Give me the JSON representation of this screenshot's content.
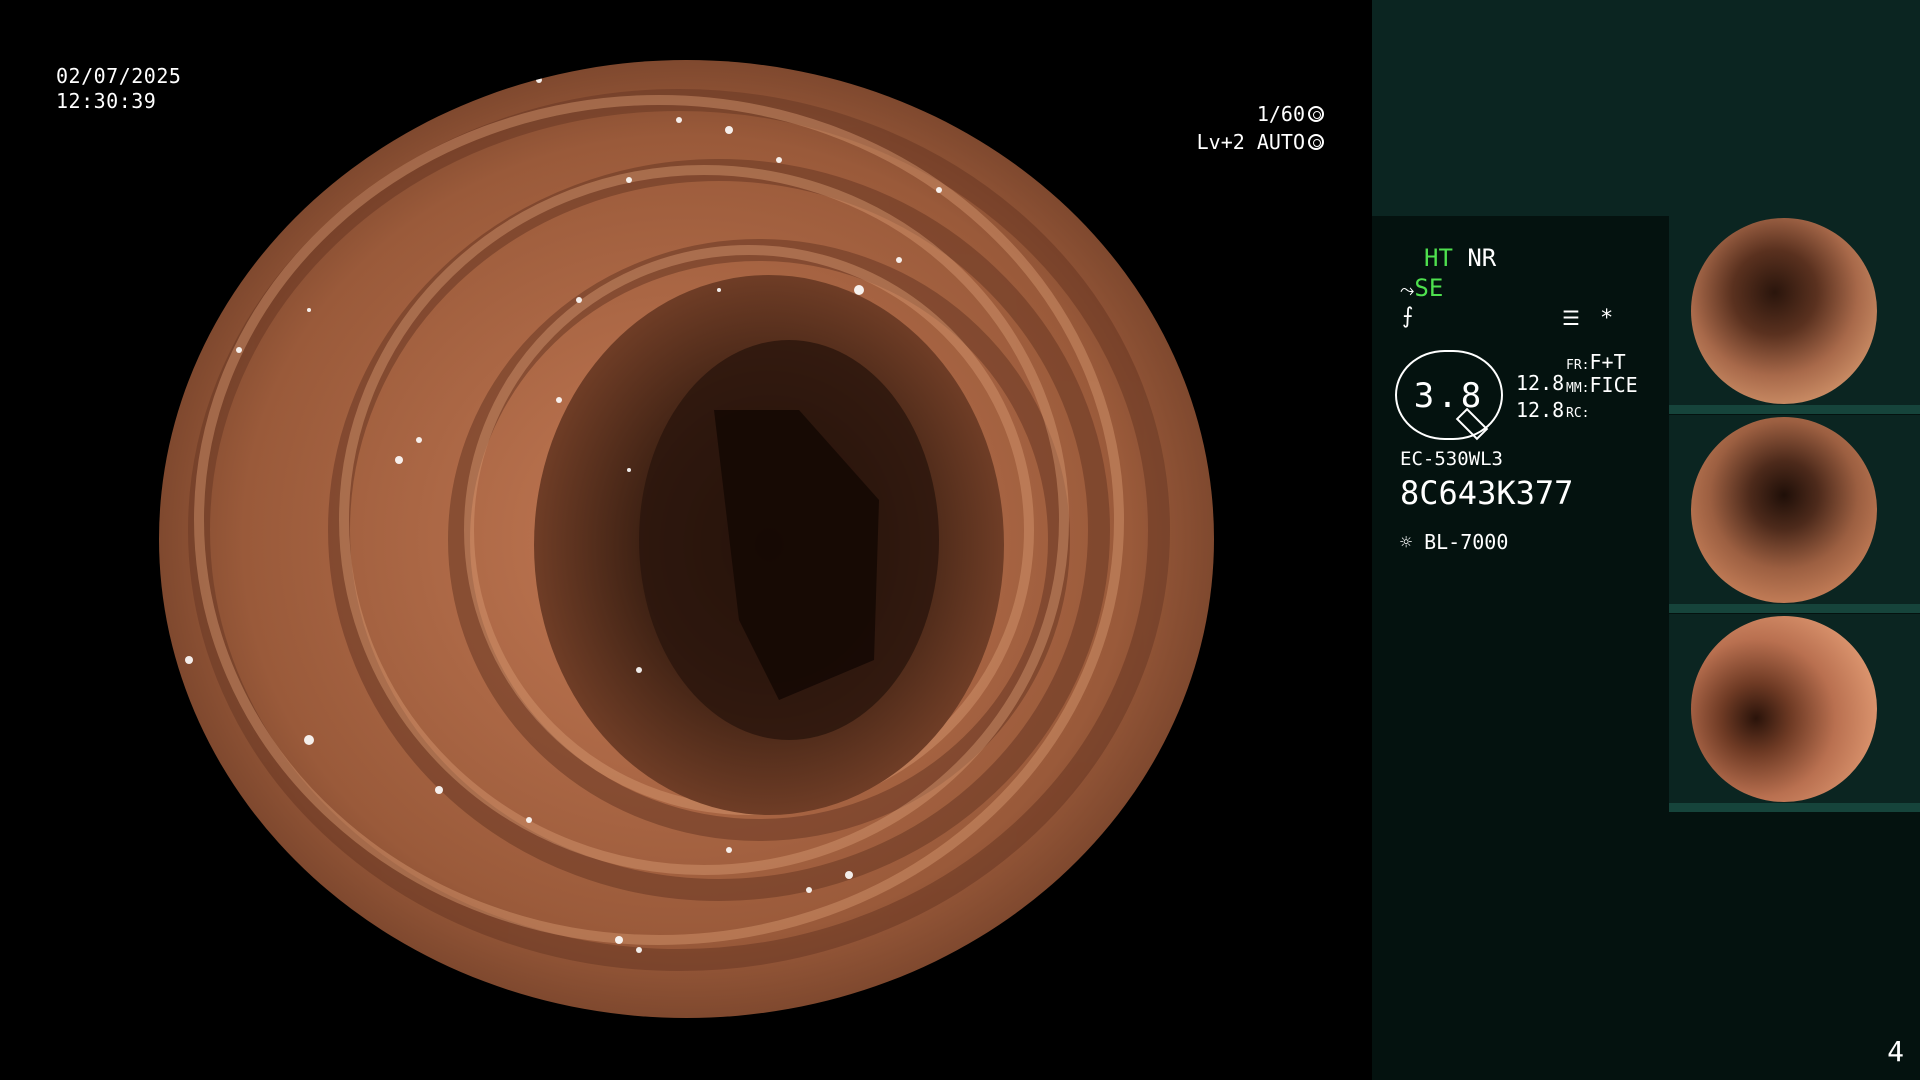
{
  "overlay": {
    "date": "02/07/2025",
    "time": "12:30:39",
    "shutter": "1/60",
    "level": "Lv+2 AUTO"
  },
  "settings": {
    "ht": "HT",
    "nr": "NR",
    "se": "SE",
    "zoom_value": "3.8",
    "focus_top": "12.8",
    "focus_bottom": "12.8",
    "fr_label": "FR:",
    "fr_value": "F+T",
    "mm_label": "MM:",
    "mm_value": "FICE",
    "rc_label": "RC:",
    "scope_model": "EC-530WL3",
    "scope_serial": "8C643K377",
    "light_source": "BL-7000",
    "asterisk": "*"
  },
  "page_number": "4",
  "colors": {
    "green_indicator": "#4ee04e",
    "panel_bg": "#04120f",
    "panel_top": "#0b2521",
    "tissue": "#9a5a3a"
  },
  "icons": [
    "shutter-icon",
    "iris-icon",
    "scope-icon",
    "flash-icon",
    "menu-icon",
    "lamp-icon"
  ]
}
